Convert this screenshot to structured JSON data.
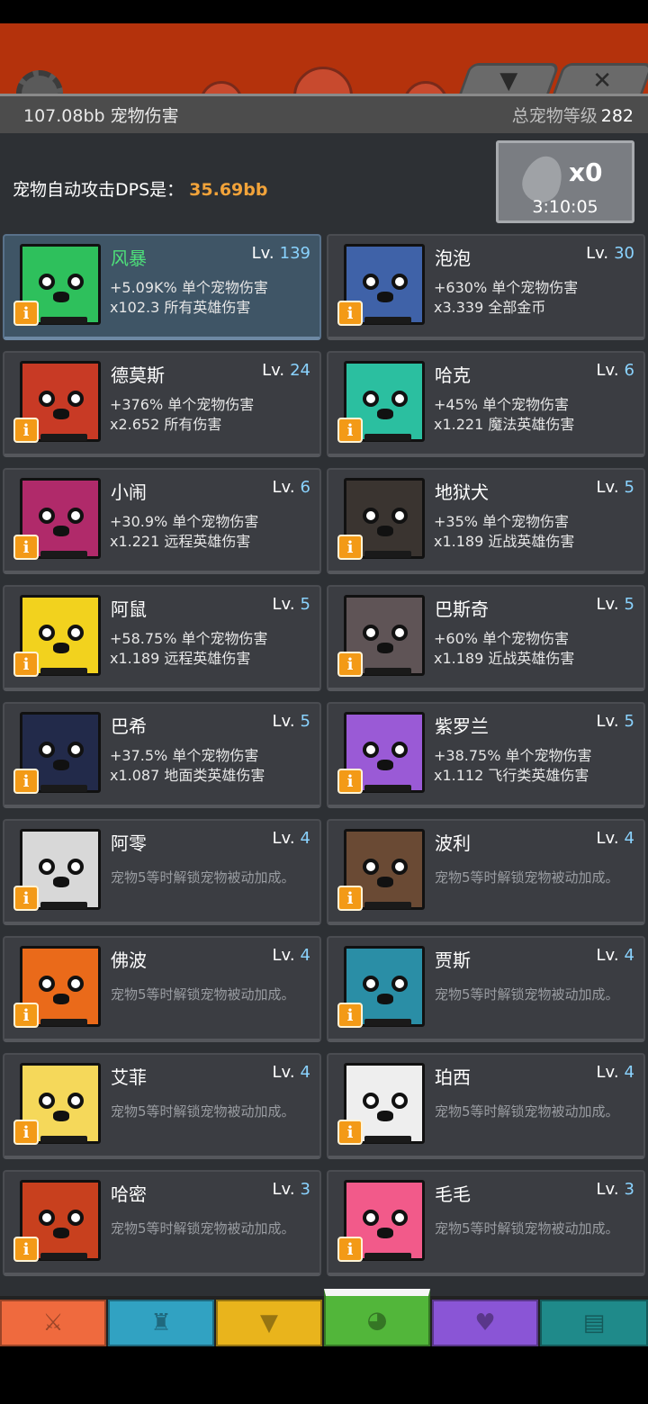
{
  "colors": {
    "panel_bg": "#2d3034",
    "card_bg": "#3b3d42",
    "selected_card_bg": "#3f5566",
    "dps_value": "#f2a33a",
    "level_number": "#8ad3ff",
    "selected_name": "#4ee07a",
    "info_button": "#f39a17"
  },
  "top_tabs": [
    {
      "icon": "chevron-down-icon",
      "glyph": "▼"
    },
    {
      "icon": "close-icon",
      "glyph": "✕"
    }
  ],
  "header": {
    "pet_damage": "107.08bb 宠物伤害",
    "total_level_label": "总宠物等级",
    "total_level_value": "282"
  },
  "dps": {
    "label": "宠物自动攻击DPS是：",
    "value": "35.69bb"
  },
  "egg": {
    "icon": "egg-icon",
    "count": "x0",
    "timer": "3:10:05"
  },
  "level_prefix": "Lv.",
  "pets": [
    {
      "name": "风暴",
      "level": "139",
      "line1": "+5.09K% 单个宠物伤害",
      "line2": "x102.3 所有英雄伤害",
      "color": "#2ec05c",
      "selected": true
    },
    {
      "name": "泡泡",
      "level": "30",
      "line1": "+630% 单个宠物伤害",
      "line2": "x3.339 全部金币",
      "color": "#3f62a8"
    },
    {
      "name": "德莫斯",
      "level": "24",
      "line1": "+376% 单个宠物伤害",
      "line2": "x2.652 所有伤害",
      "color": "#c83a25"
    },
    {
      "name": "哈克",
      "level": "6",
      "line1": "+45% 单个宠物伤害",
      "line2": "x1.221 魔法英雄伤害",
      "color": "#2bbfa0"
    },
    {
      "name": "小闹",
      "level": "6",
      "line1": "+30.9% 单个宠物伤害",
      "line2": "x1.221 远程英雄伤害",
      "color": "#b02a6a"
    },
    {
      "name": "地狱犬",
      "level": "5",
      "line1": "+35% 单个宠物伤害",
      "line2": "x1.189 近战英雄伤害",
      "color": "#3a3430"
    },
    {
      "name": "阿鼠",
      "level": "5",
      "line1": "+58.75% 单个宠物伤害",
      "line2": "x1.189 远程英雄伤害",
      "color": "#f2d21e"
    },
    {
      "name": "巴斯奇",
      "level": "5",
      "line1": "+60% 单个宠物伤害",
      "line2": "x1.189 近战英雄伤害",
      "color": "#5f5456"
    },
    {
      "name": "巴希",
      "level": "5",
      "line1": "+37.5% 单个宠物伤害",
      "line2": "x1.087 地面类英雄伤害",
      "color": "#222a4a"
    },
    {
      "name": "紫罗兰",
      "level": "5",
      "line1": "+38.75% 单个宠物伤害",
      "line2": "x1.112 飞行类英雄伤害",
      "color": "#9a5ad6"
    },
    {
      "name": "阿零",
      "level": "4",
      "locked": "宠物5等时解锁宠物被动加成。",
      "color": "#d8d8d8"
    },
    {
      "name": "波利",
      "level": "4",
      "locked": "宠物5等时解锁宠物被动加成。",
      "color": "#6a4a34"
    },
    {
      "name": "佛波",
      "level": "4",
      "locked": "宠物5等时解锁宠物被动加成。",
      "color": "#ea6a1a"
    },
    {
      "name": "贾斯",
      "level": "4",
      "locked": "宠物5等时解锁宠物被动加成。",
      "color": "#2a8ea6"
    },
    {
      "name": "艾菲",
      "level": "4",
      "locked": "宠物5等时解锁宠物被动加成。",
      "color": "#f5d85a"
    },
    {
      "name": "珀西",
      "level": "4",
      "locked": "宠物5等时解锁宠物被动加成。",
      "color": "#eeeeee"
    },
    {
      "name": "哈密",
      "level": "3",
      "locked": "宠物5等时解锁宠物被动加成。",
      "color": "#c8401e"
    },
    {
      "name": "毛毛",
      "level": "3",
      "locked": "宠物5等时解锁宠物被动加成。",
      "color": "#f25a8a"
    }
  ],
  "bottom_tabs": [
    {
      "icon": "sword-icon",
      "glyph": "⚔",
      "color": "#ef6a3e"
    },
    {
      "icon": "helmet-icon",
      "glyph": "♜",
      "color": "#31a2c2"
    },
    {
      "icon": "armor-icon",
      "glyph": "▼",
      "color": "#e9b41c"
    },
    {
      "icon": "pet-icon",
      "glyph": "◕",
      "color": "#52b63a",
      "active": true
    },
    {
      "icon": "heart-icon",
      "glyph": "♥",
      "color": "#8a55d6"
    },
    {
      "icon": "scroll-icon",
      "glyph": "▤",
      "color": "#1f8a8a"
    }
  ]
}
